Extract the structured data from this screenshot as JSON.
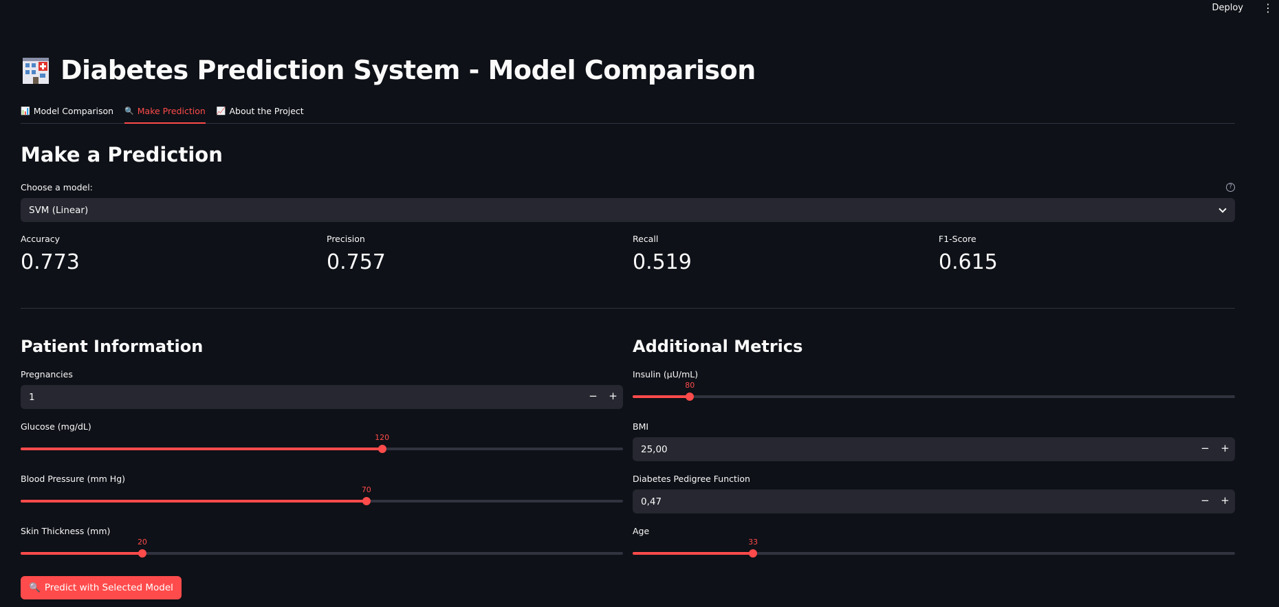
{
  "header": {
    "deploy_label": "Deploy",
    "menu_glyph": "⋮"
  },
  "title": "Diabetes Prediction System - Model Comparison",
  "tabs": [
    {
      "icon": "📊",
      "label": "Model Comparison",
      "active": false
    },
    {
      "icon": "🔍",
      "label": "Make Prediction",
      "active": true
    },
    {
      "icon": "📈",
      "label": "About the Project",
      "active": false
    }
  ],
  "section_title": "Make a Prediction",
  "model_select": {
    "label": "Choose a model:",
    "help_glyph": "?",
    "value": "SVM (Linear)"
  },
  "metrics": [
    {
      "label": "Accuracy",
      "value": "0.773"
    },
    {
      "label": "Precision",
      "value": "0.757"
    },
    {
      "label": "Recall",
      "value": "0.519"
    },
    {
      "label": "F1-Score",
      "value": "0.615"
    }
  ],
  "patient": {
    "title": "Patient Information",
    "pregnancies": {
      "label": "Pregnancies",
      "value": "1"
    },
    "glucose": {
      "label": "Glucose (mg/dL)",
      "value": "120",
      "fraction": 0.6
    },
    "blood_pressure": {
      "label": "Blood Pressure (mm Hg)",
      "value": "70",
      "fraction": 0.574
    },
    "skin_thickness": {
      "label": "Skin Thickness (mm)",
      "value": "20",
      "fraction": 0.202
    }
  },
  "additional": {
    "title": "Additional Metrics",
    "insulin": {
      "label": "Insulin (μU/mL)",
      "value": "80",
      "fraction": 0.095
    },
    "bmi": {
      "label": "BMI",
      "value": "25,00"
    },
    "dpf": {
      "label": "Diabetes Pedigree Function",
      "value": "0,47"
    },
    "age": {
      "label": "Age",
      "value": "33",
      "fraction": 0.2
    }
  },
  "stepper": {
    "minus": "−",
    "plus": "+"
  },
  "predict_button": {
    "icon": "🔍",
    "label": "Predict with Selected Model"
  },
  "colors": {
    "background": "#0e1117",
    "accent": "#ff4b4b",
    "input_bg": "#262730",
    "track": "#31333f"
  }
}
